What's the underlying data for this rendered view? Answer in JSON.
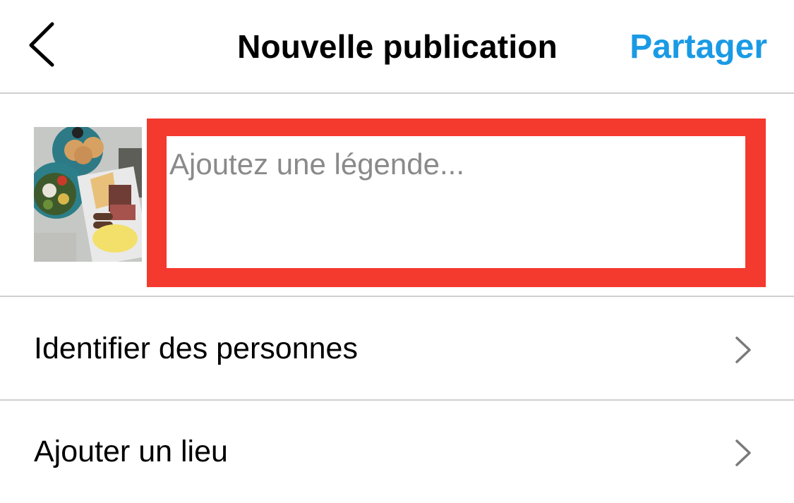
{
  "header": {
    "back_icon": "chevron-left-icon",
    "title": "Nouvelle publication",
    "share_label": "Partager",
    "share_color": "#1a9ae5"
  },
  "composer": {
    "thumbnail": "food-photo-thumbnail",
    "caption_placeholder": "Ajoutez une légende...",
    "caption_value": "",
    "highlight_color": "#f4392f"
  },
  "options": [
    {
      "label": "Identifier des personnes",
      "icon": "chevron-right-icon"
    },
    {
      "label": "Ajouter un lieu",
      "icon": "chevron-right-icon"
    }
  ]
}
